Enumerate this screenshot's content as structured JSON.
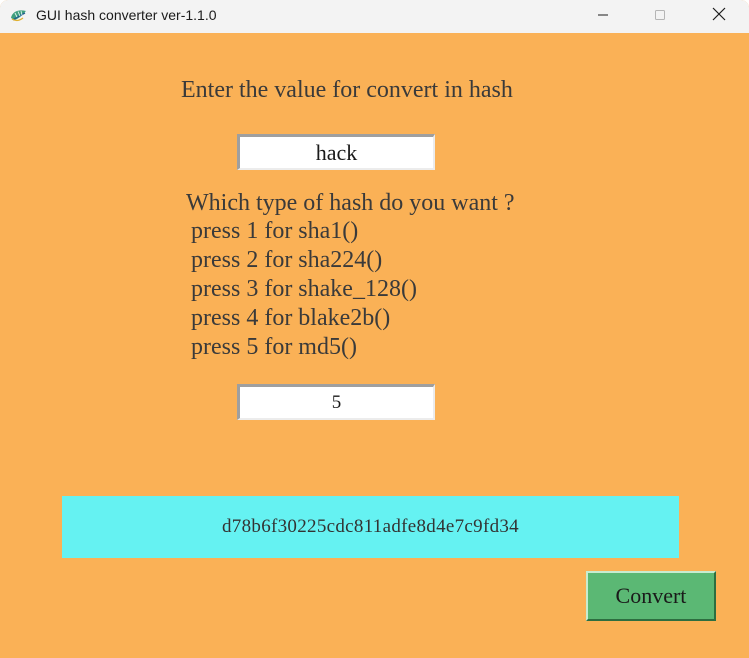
{
  "window": {
    "title": "GUI hash converter ver-1.1.0",
    "app_icon": "python-feather-icon",
    "controls": {
      "minimize_icon": "minimize-icon",
      "maximize_icon": "maximize-icon",
      "close_icon": "close-icon"
    }
  },
  "form": {
    "heading": "Enter the value for convert in hash",
    "value_input": "hack",
    "question": "Which type of hash do you want ?",
    "options": [
      "press 1 for sha1()",
      "press 2 for sha224()",
      "press 3 for shake_128()",
      "press 4 for blake2b()",
      "press 5 for md5()"
    ],
    "choice_input": "5"
  },
  "result": {
    "hash": "d78b6f30225cdc811adfe8d4e7c9fd34"
  },
  "convert_button": {
    "label": "Convert"
  },
  "colors": {
    "background": "#fab156",
    "result_background": "#65f2f2",
    "button_background": "#5bb874",
    "titlebar": "#f3f3f3"
  }
}
